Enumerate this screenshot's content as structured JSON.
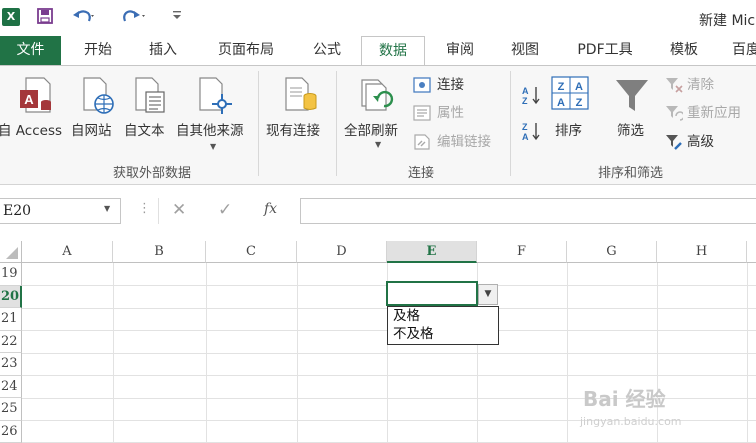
{
  "qat": {
    "logo": "X",
    "title": "新建 Mic"
  },
  "tabs": [
    {
      "label": "文件"
    },
    {
      "label": "开始"
    },
    {
      "label": "插入"
    },
    {
      "label": "页面布局"
    },
    {
      "label": "公式"
    },
    {
      "label": "数据"
    },
    {
      "label": "审阅"
    },
    {
      "label": "视图"
    },
    {
      "label": "PDF工具"
    },
    {
      "label": "模板"
    },
    {
      "label": "百度"
    }
  ],
  "ribbon": {
    "get_external": {
      "access": "自 Access",
      "web": "自网站",
      "text": "自文本",
      "other": "自其他来源",
      "label": "获取外部数据"
    },
    "existing": "现有连接",
    "connections": {
      "refresh_all": "全部刷新",
      "connect": "连接",
      "properties": "属性",
      "edit_links": "编辑链接",
      "label": "连接"
    },
    "sort_filter": {
      "sort": "排序",
      "filter": "筛选",
      "clear": "清除",
      "reapply": "重新应用",
      "advanced": "高级",
      "label": "排序和筛选"
    }
  },
  "formula_bar": {
    "name_box": "E20",
    "fx": "fx"
  },
  "grid": {
    "columns": [
      "A",
      "B",
      "C",
      "D",
      "E",
      "F",
      "G",
      "H"
    ],
    "rows": [
      "19",
      "20",
      "21",
      "22",
      "23",
      "24",
      "25",
      "26"
    ],
    "selected_column": "E",
    "selected_row": "20"
  },
  "dropdown": {
    "options": [
      "及格",
      "不及格"
    ]
  },
  "watermark": {
    "brand": "Bai 经验",
    "url": "jingyan.baidu.com"
  },
  "colors": {
    "accent": "#217346"
  }
}
